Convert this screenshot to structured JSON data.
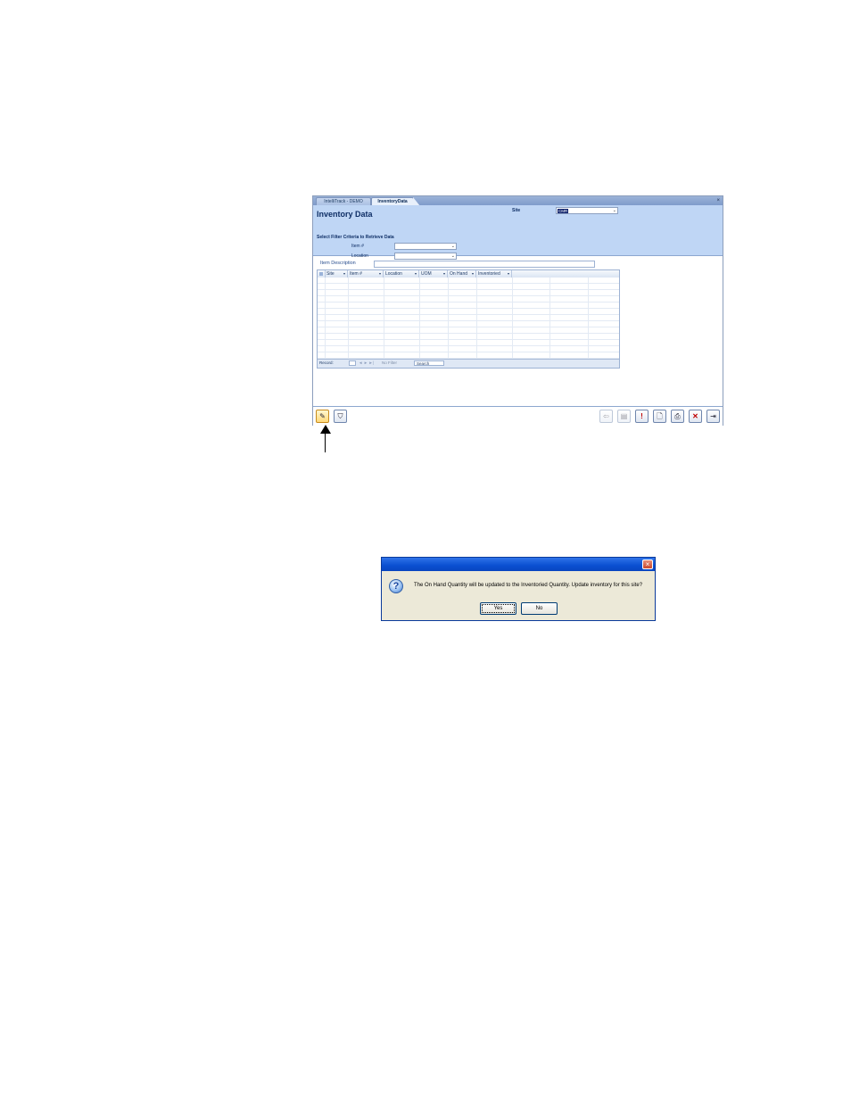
{
  "app": {
    "tabs": [
      "IntelliTrack - DEMO",
      "InventoryData"
    ],
    "close_glyph": "×",
    "title": "Inventory Data",
    "site_label": "Site",
    "site_value": "CMR",
    "filter_title": "Select Filter Criteria to Retrieve Data",
    "item_label": "Item #",
    "location_label": "Location",
    "item_description_label": "Item Description",
    "grid_columns": [
      "Site",
      "Item #",
      "Location",
      "UOM",
      "On Hand",
      "Inventoried"
    ],
    "grid_nav": {
      "record_label": "Record:",
      "no_filter": "No Filter",
      "search": "Search"
    }
  },
  "icons": {
    "update-inventory": "pencil-icon",
    "filter": "filter-funnel-icon",
    "back": "arrow-left-icon",
    "forward": "page-icon",
    "exclaim": "exclamation-icon",
    "preview": "report-preview-icon",
    "print": "printer-icon",
    "delete": "x-delete-icon",
    "exit": "exit-door-icon"
  },
  "dialog": {
    "message": "The On Hand Quantity will be updated to the Inventoried Quantity. Update inventory for this site?",
    "yes_label": "Yes",
    "no_label": "No"
  }
}
